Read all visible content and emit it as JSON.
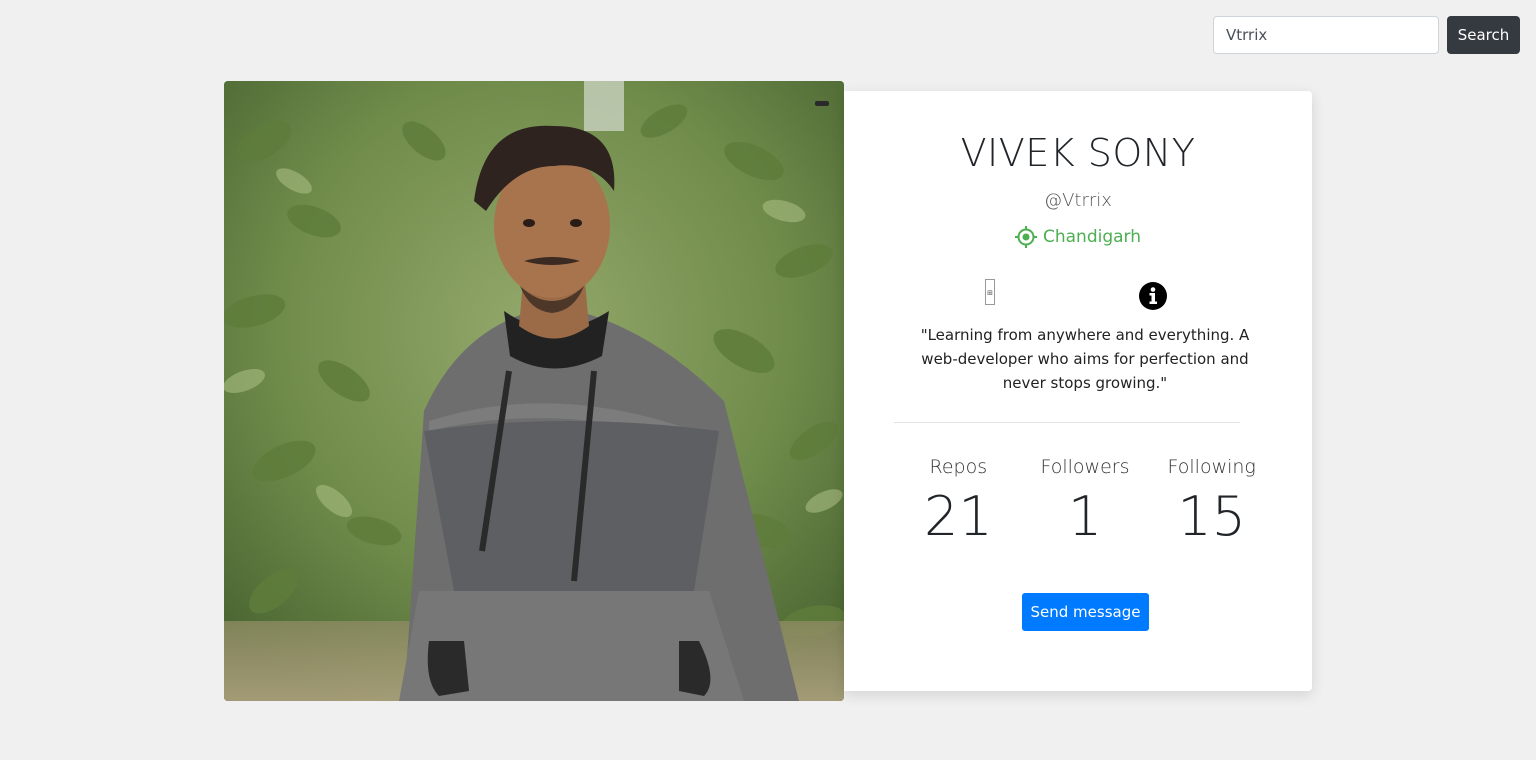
{
  "search": {
    "value": "Vtrrix",
    "button_label": "Search"
  },
  "profile": {
    "name": "VIVEK SONY",
    "handle": "@Vtrrix",
    "location": "Chandigarh",
    "location_icon": "location-target-icon",
    "bio": "\"Learning from anywhere and everything. A web-developer who aims for perfection and never stops growing.\"",
    "broken_image_text": "",
    "info_icon": "info-circle-icon"
  },
  "stats": [
    {
      "label": "Repos",
      "value": "21"
    },
    {
      "label": "Followers",
      "value": "1"
    },
    {
      "label": "Following",
      "value": "15"
    }
  ],
  "actions": {
    "send_message_label": "Send message"
  },
  "colors": {
    "background": "#f0f0f0",
    "accent_blue": "#007bff",
    "dark_button": "#343a40",
    "location_green": "#4caf50"
  }
}
